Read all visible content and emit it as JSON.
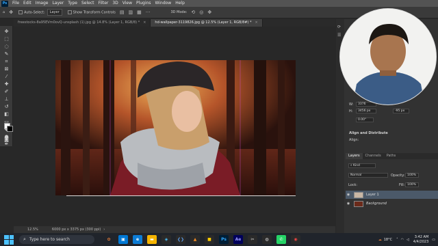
{
  "menubar": {
    "items": [
      "File",
      "Edit",
      "Image",
      "Layer",
      "Type",
      "Select",
      "Filter",
      "3D",
      "View",
      "Plugins",
      "Window",
      "Help"
    ]
  },
  "options": {
    "auto_select_label": "Auto-Select:",
    "auto_select_value": "Layer",
    "transform_label": "Show Transform Controls",
    "mode_label": "3D Mode:"
  },
  "tabs": [
    {
      "label": "freestocks-8a95EVm0ovQ-unsplash (1).jpg @ 14.8% (Layer 1, RGB/8) *",
      "close": "×"
    },
    {
      "label": "hd-wallpaper-3119826.jpg @ 12.5% (Layer 1, RGB/8#) *",
      "close": "×"
    }
  ],
  "status": {
    "zoom": "12.5%",
    "dimensions": "6000 px x 3375 px (300 ppi)"
  },
  "properties": {
    "w_label": "W:",
    "w_value": "3376",
    "h_label": "H:",
    "h_value": "3456 px",
    "y_value": "-95 px",
    "angle": "0.00°",
    "align_title": "Align and Distribute",
    "align_label": "Align:"
  },
  "layers_panel": {
    "tabs": [
      "Layers",
      "Channels",
      "Paths"
    ],
    "kind_label": "Kind",
    "blend_mode": "Normal",
    "opacity_label": "Opacity:",
    "opacity_value": "100%",
    "lock_label": "Lock:",
    "fill_label": "Fill:",
    "fill_value": "100%",
    "layers": [
      {
        "name": "Layer 1",
        "selected": true
      },
      {
        "name": "Background",
        "selected": false
      }
    ]
  },
  "taskbar": {
    "search_placeholder": "Type here to search",
    "temperature": "18°C",
    "time": "3:42 AM",
    "date": "4/4/2023"
  },
  "colors": {
    "accent": "#31a8ff",
    "menubar": "#535353",
    "panel": "#323232",
    "selected_layer": "#4b5969"
  }
}
